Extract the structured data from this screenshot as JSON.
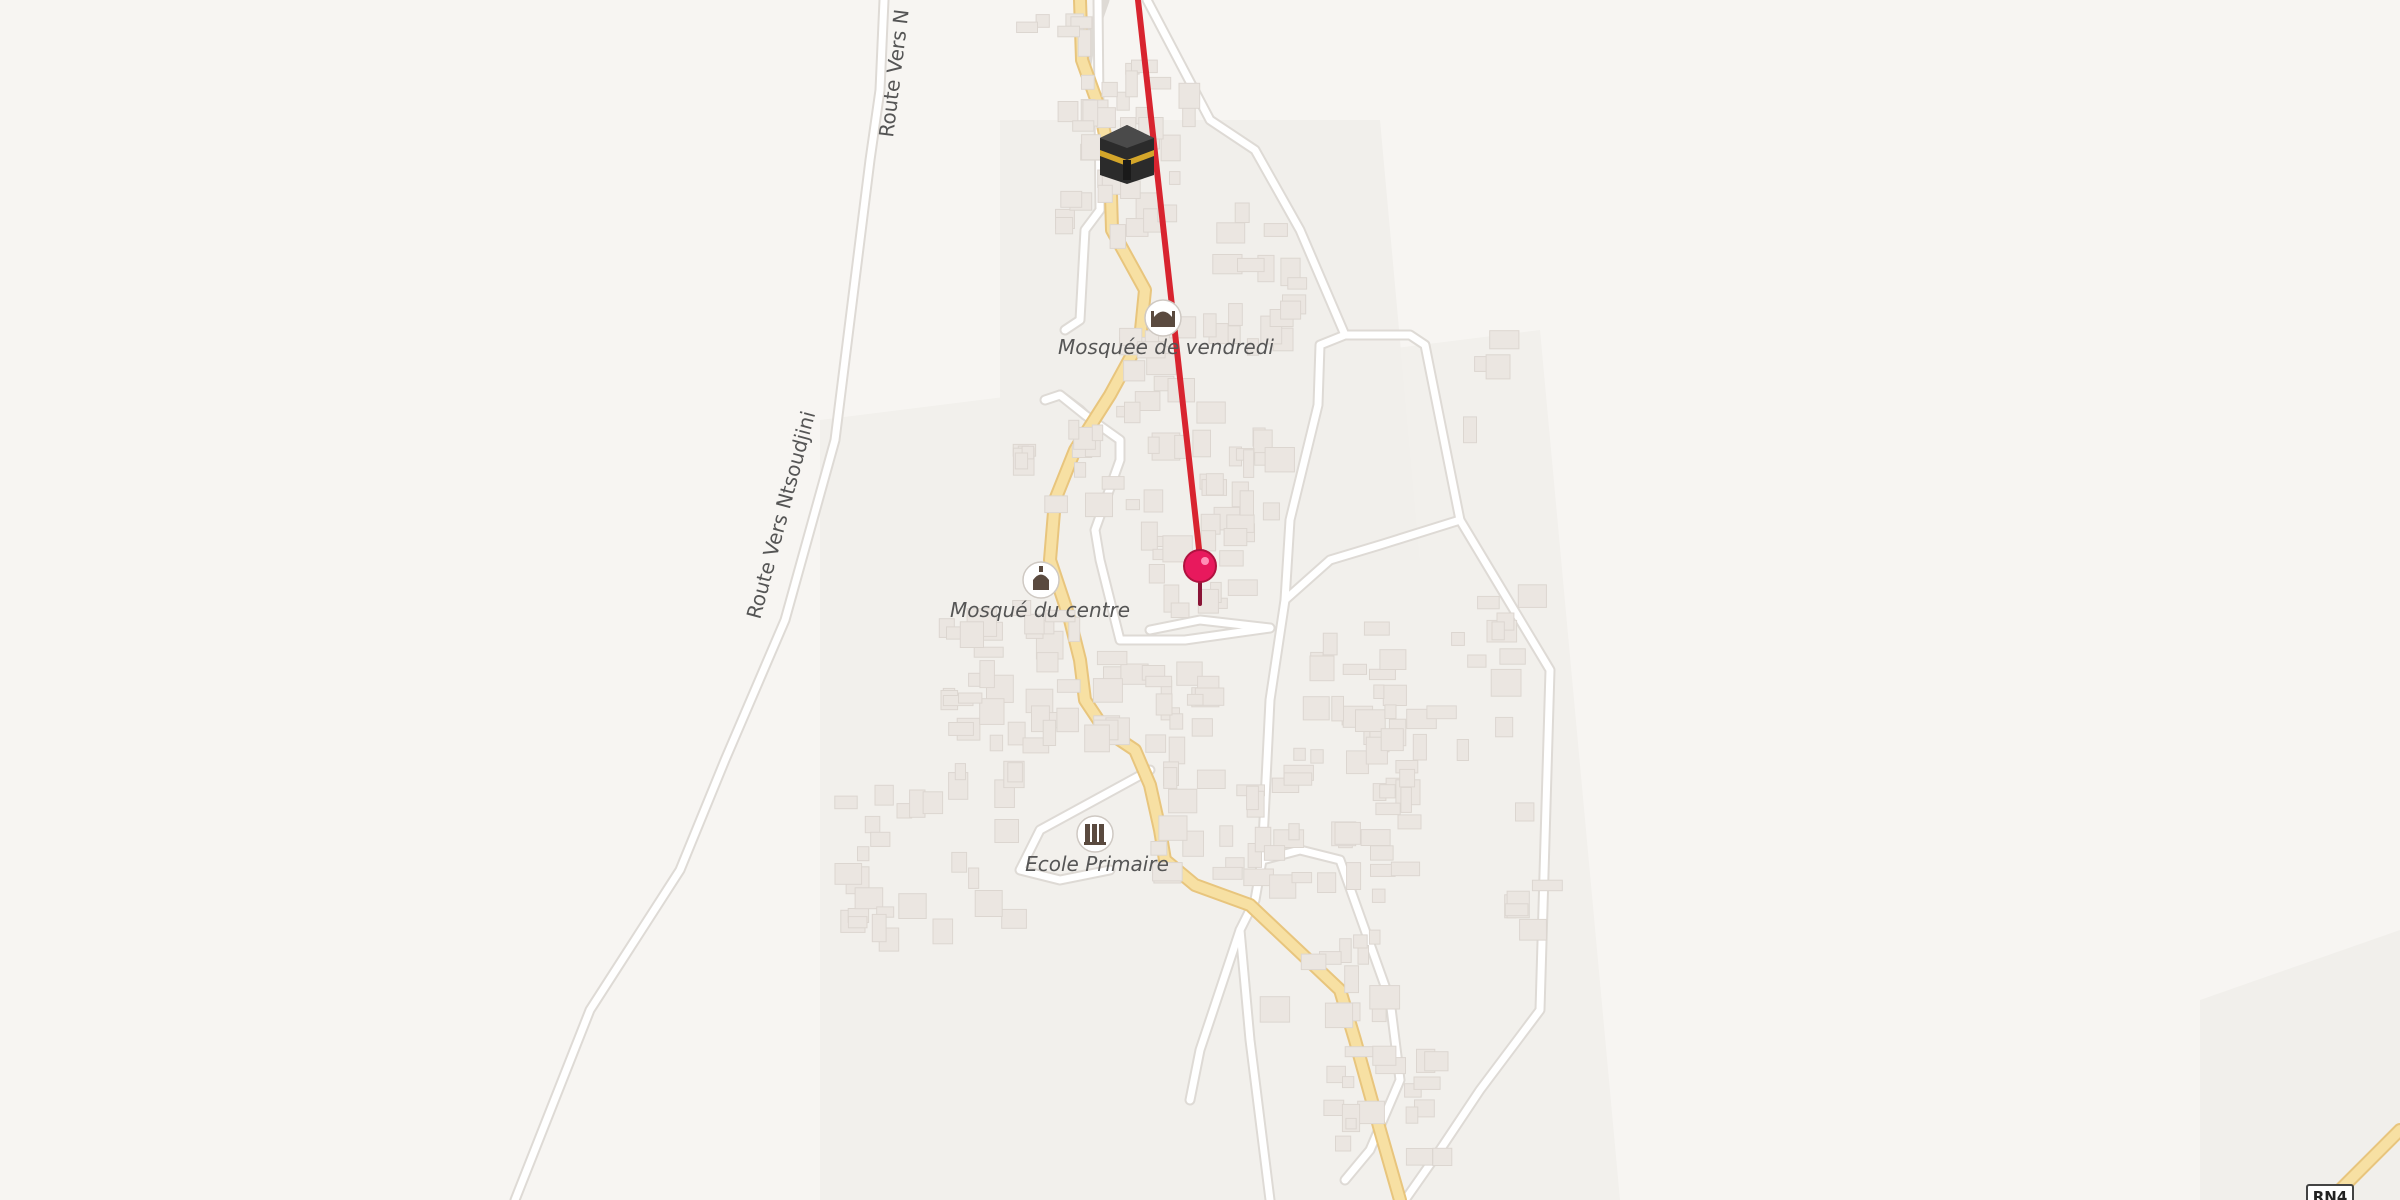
{
  "map": {
    "labels": {
      "road_ntsoudjini_top": "Route Vers N",
      "road_ntsoudjini": "Route Vers Ntsoudjini",
      "mosque_friday": "Mosquée de vendredi",
      "mosque_center": "Mosqué du centre",
      "school": "Ecole Primaire",
      "road_shield": "RN4"
    },
    "icons": {
      "mosque_friday": "mosque-icon",
      "mosque_center": "mosque-icon",
      "school": "school-icon",
      "kaaba": "kaaba-icon",
      "pin": "location-pin-icon"
    },
    "colors": {
      "background": "#f7f5f2",
      "land_patch": "#f1efeb",
      "minor_road": "#ffffff",
      "minor_road_casing": "#dedad5",
      "primary_road": "#f7e0a3",
      "primary_road_casing": "#e8c57d",
      "qibla_line": "#d8242f",
      "pin": "#e8195d",
      "building": "#ebe6e1"
    }
  }
}
